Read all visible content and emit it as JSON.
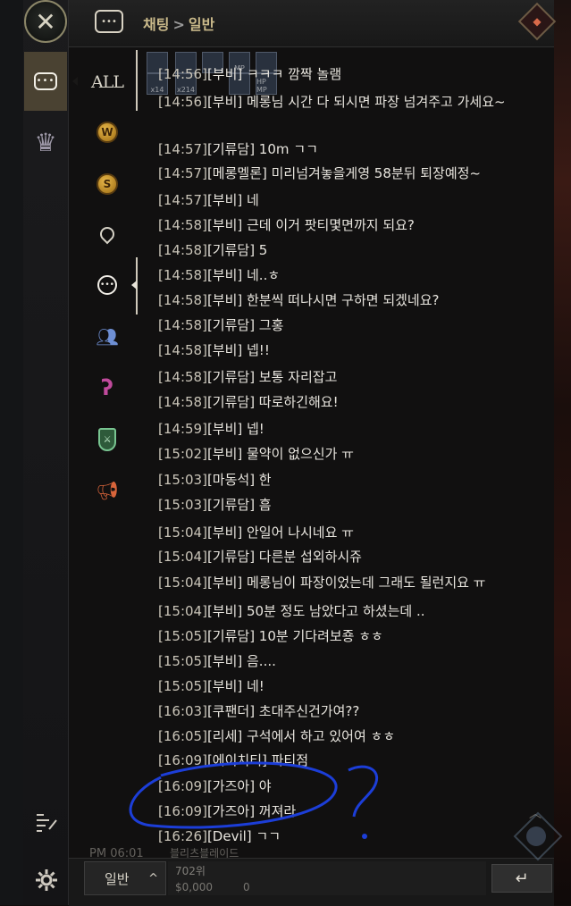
{
  "header": {
    "breadcrumb_root": "채팅",
    "breadcrumb_sep": ">",
    "breadcrumb_current": "일반"
  },
  "channels": {
    "all_label": "ALL",
    "world_letter": "W",
    "server_letter": "S"
  },
  "messages": [
    {
      "time": "[14:56]",
      "text": "[부비] ㅋㅋㅋ 깜짝 놀램"
    },
    {
      "time": "[14:56]",
      "text": "[부비] 메롱님 시간 다 되시면 파장 넘겨주고 가세요~"
    },
    {
      "time": "[14:57]",
      "text": "[기류담] 10m ㄱㄱ"
    },
    {
      "time": "[14:57]",
      "text": "[메롱멜론] 미리넘겨놓을게영 58분뒤 퇴장예정~"
    },
    {
      "time": "[14:57]",
      "text": "[부비] 네"
    },
    {
      "time": "[14:58]",
      "text": "[부비] 근데 이거 팟티몇면까지 되요?"
    },
    {
      "time": "[14:58]",
      "text": "[기류담] 5"
    },
    {
      "time": "[14:58]",
      "text": "[부비] 네..ㅎ"
    },
    {
      "time": "[14:58]",
      "text": "[부비] 한분씩 떠나시면 구하면 되겠네요?"
    },
    {
      "time": "[14:58]",
      "text": "[기류담] 그홍"
    },
    {
      "time": "[14:58]",
      "text": "[부비] 넵!!"
    },
    {
      "time": "[14:58]",
      "text": "[기류담] 보통 자리잡고"
    },
    {
      "time": "[14:58]",
      "text": "[기류담] 따로하긴해요!"
    },
    {
      "time": "[14:59]",
      "text": "[부비] 넵!"
    },
    {
      "time": "[15:02]",
      "text": "[부비] 물약이 없으신가 ㅠ"
    },
    {
      "time": "[15:03]",
      "text": "[마동석] 한"
    },
    {
      "time": "[15:03]",
      "text": "[기류담] 흠"
    },
    {
      "time": "[15:04]",
      "text": "[부비] 안일어 나시네요 ㅠ"
    },
    {
      "time": "[15:04]",
      "text": "[기류담] 다른분 섭외하시쥬"
    },
    {
      "time": "[15:04]",
      "text": "[부비] 메롱님이 파장이었는데 그래도 될런지요 ㅠ"
    },
    {
      "time": "[15:04]",
      "text": "[부비] 50분 정도 남았다고 하셨는데 .."
    },
    {
      "time": "[15:05]",
      "text": "[기류담] 10분 기다려보죵 ㅎㅎ"
    },
    {
      "time": "[15:05]",
      "text": "[부비] 음...."
    },
    {
      "time": "[15:05]",
      "text": "[부비] 네!"
    },
    {
      "time": "[16:03]",
      "text": "[쿠팬더] 초대주신건가여??"
    },
    {
      "time": "[16:05]",
      "text": "[리세] 구석에서 하고 있어여 ㅎㅎ"
    },
    {
      "time": "[16:09]",
      "text": "[에이치티] 파티점"
    },
    {
      "time": "[16:09]",
      "text": "[가즈아] 야"
    },
    {
      "time": "[16:09]",
      "text": "[가즈아] 꺼져라"
    },
    {
      "time": "[16:26]",
      "text": "[Devil] ㄱㄱ"
    }
  ],
  "overlay": {
    "buff_labels": [
      "x14",
      "x214",
      "MP",
      "HP MP"
    ],
    "ghost_time": "PM 06:01",
    "ghost_name": "블리츠블레이드",
    "ghost_rank": "702위",
    "ghost_gold": "$0,000",
    "ghost_zero": "0"
  },
  "bottom": {
    "channel_value": "일반",
    "channel_caret": "^",
    "send_icon": "↵"
  },
  "annotation": {
    "color": "#1c3ed8",
    "mark": "?"
  }
}
